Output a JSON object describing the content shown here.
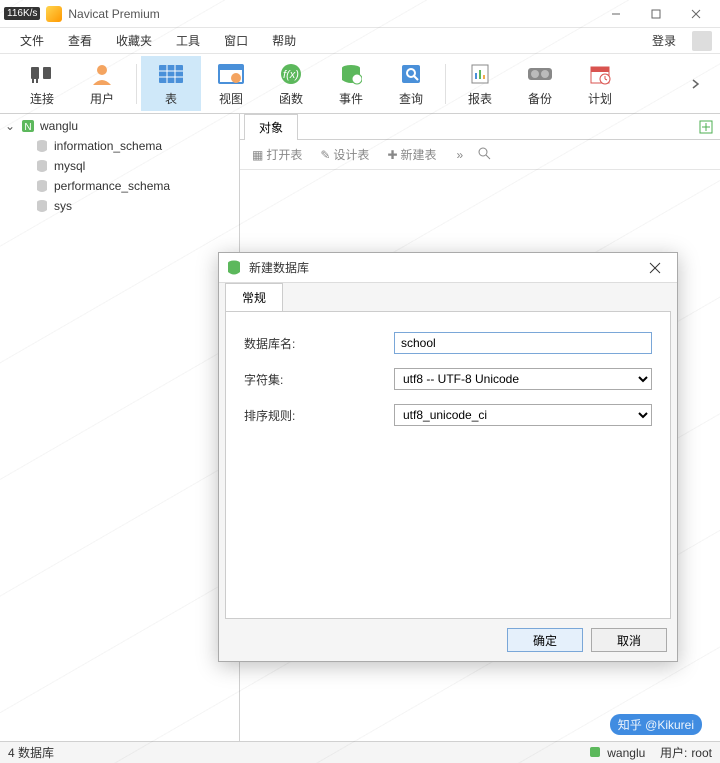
{
  "titlebar": {
    "speed": "116K/s",
    "title": "Navicat Premium"
  },
  "menubar": {
    "items": [
      "文件",
      "查看",
      "收藏夹",
      "工具",
      "窗口",
      "帮助"
    ],
    "login": "登录"
  },
  "toolbar": {
    "items": [
      {
        "label": "连接",
        "icon": "plug"
      },
      {
        "label": "用户",
        "icon": "user"
      },
      {
        "label": "表",
        "icon": "table",
        "active": true
      },
      {
        "label": "视图",
        "icon": "view"
      },
      {
        "label": "函数",
        "icon": "fx"
      },
      {
        "label": "事件",
        "icon": "event"
      },
      {
        "label": "查询",
        "icon": "query"
      },
      {
        "label": "报表",
        "icon": "report"
      },
      {
        "label": "备份",
        "icon": "backup"
      },
      {
        "label": "计划",
        "icon": "schedule"
      }
    ]
  },
  "sidebar": {
    "connection": "wanglu",
    "databases": [
      "information_schema",
      "mysql",
      "performance_schema",
      "sys"
    ]
  },
  "content": {
    "tab": "对象",
    "tools": [
      "打开表",
      "设计表",
      "新建表"
    ]
  },
  "dialog": {
    "title": "新建数据库",
    "tab": "常规",
    "fields": {
      "name_label": "数据库名:",
      "name_value": "school",
      "charset_label": "字符集:",
      "charset_value": "utf8 -- UTF-8 Unicode",
      "collation_label": "排序规则:",
      "collation_value": "utf8_unicode_ci"
    },
    "ok": "确定",
    "cancel": "取消"
  },
  "statusbar": {
    "left": "4 数据库",
    "connection": "wanglu",
    "user_label": "用户:",
    "user_value": "root"
  },
  "watermark": "知乎 @Kikurei"
}
